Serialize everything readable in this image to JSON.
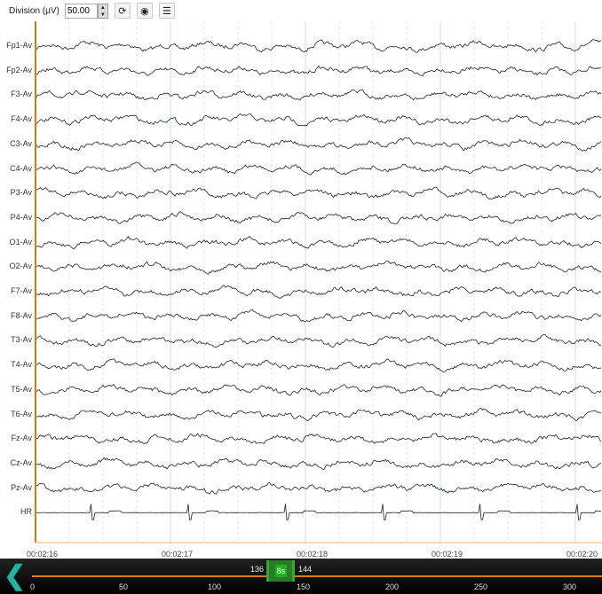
{
  "toolbar": {
    "division_label": "Division (µV)",
    "division_value": "50.00",
    "icons": [
      "refresh-icon",
      "montage-icon",
      "checklist-icon"
    ]
  },
  "channels": [
    "Fp1-Av",
    "Fp2-Av",
    "F3-Av",
    "F4-Av",
    "C3-Av",
    "C4-Av",
    "P3-Av",
    "P4-Av",
    "O1-Av",
    "O2-Av",
    "F7-Av",
    "F8-Av",
    "T3-Av",
    "T4-Av",
    "T5-Av",
    "T6-Av",
    "Fz-Av",
    "Cz-Av",
    "Pz-Av",
    "HR"
  ],
  "time_labels": [
    "00:02:16",
    "00:02:17",
    "00:02:18",
    "00:02:19",
    "00:02:20"
  ],
  "timeline": {
    "ticks": [
      "0",
      "50",
      "100",
      "150",
      "200",
      "250",
      "300"
    ],
    "window_start": "136",
    "window_length": "8s",
    "window_end": "144"
  },
  "colors": {
    "cursor": "#e07a10",
    "window": "#1cb31c",
    "back": "#1fb5a5"
  }
}
